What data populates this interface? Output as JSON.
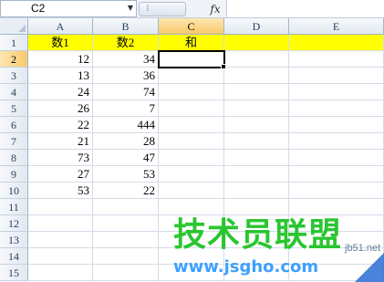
{
  "formula_bar": {
    "name_box": "C2",
    "dropdown_icon": "chevron-down-icon",
    "fx_label": "fx",
    "formula": ""
  },
  "columns": [
    "A",
    "B",
    "C",
    "D",
    "E"
  ],
  "rows": [
    "1",
    "2",
    "3",
    "4",
    "5",
    "6",
    "7",
    "8",
    "9",
    "10",
    "11",
    "12",
    "13",
    "14",
    "15"
  ],
  "active_cell": "C2",
  "header_row": {
    "a": "数1",
    "b": "数2",
    "c": "和",
    "highlight_color": "#ffff00"
  },
  "data": [
    {
      "a": "12",
      "b": "34"
    },
    {
      "a": "13",
      "b": "36"
    },
    {
      "a": "24",
      "b": "74"
    },
    {
      "a": "26",
      "b": "7"
    },
    {
      "a": "22",
      "b": "444"
    },
    {
      "a": "21",
      "b": "28"
    },
    {
      "a": "73",
      "b": "47"
    },
    {
      "a": "27",
      "b": "53"
    },
    {
      "a": "53",
      "b": "22"
    }
  ],
  "watermark": {
    "main": "技术员联盟",
    "domain": "jb51.net",
    "url": "www.jsgho.com",
    "color": "#18c21f"
  }
}
